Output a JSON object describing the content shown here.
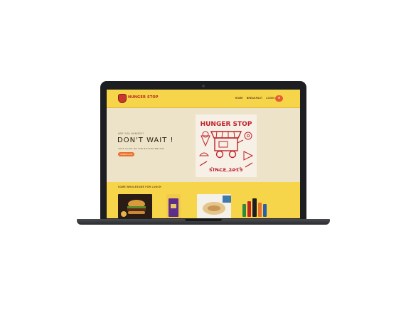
{
  "site": {
    "brand": "HUNGER STOP",
    "nav": [
      "HOME",
      "BREAKFAST",
      "LOGIN"
    ],
    "cart_icon": "cart-icon"
  },
  "hero": {
    "kicker": "ARE YOU HUNGRY?",
    "title": "DON'T WAIT !",
    "subtitle": "JUST CLICK ON THE BUTTON BELOW",
    "button": "ORDER NOW",
    "art": {
      "heading": "HUNGER STOP",
      "footer": "SINCE 2019",
      "color": "#c0242b"
    }
  },
  "menu": {
    "title": "SOME WHOLESOME FOR LUNCH",
    "items": [
      {
        "icon": "burger-image"
      },
      {
        "icon": "snack-bag-image"
      },
      {
        "icon": "wrap-image"
      },
      {
        "icon": "drinks-image"
      }
    ]
  },
  "colors": {
    "header": "#f7d54a",
    "hero_bg": "#ece3c8",
    "accent": "#e9702c",
    "brand_red": "#c0242b"
  }
}
